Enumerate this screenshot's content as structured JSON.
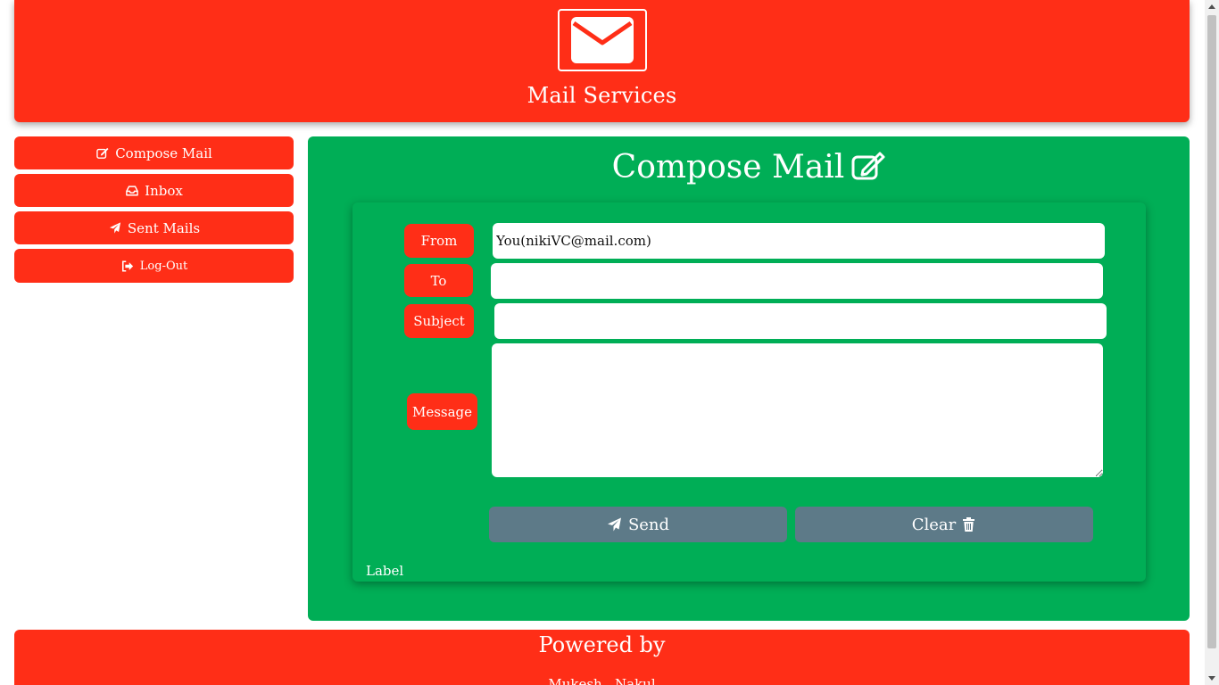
{
  "header": {
    "title": "Mail Services",
    "logo_icon": "envelope-icon"
  },
  "sidebar": {
    "items": [
      {
        "label": "Compose Mail",
        "icon": "edit-icon"
      },
      {
        "label": "Inbox",
        "icon": "inbox-icon"
      },
      {
        "label": "Sent Mails",
        "icon": "paper-plane-icon"
      },
      {
        "label": "Log-Out",
        "icon": "sign-out-icon"
      }
    ]
  },
  "compose": {
    "title": "Compose Mail",
    "from_label": "From",
    "from_value": "You(nikiVC@mail.com)",
    "to_label": "To",
    "to_value": "",
    "subject_label": "Subject",
    "subject_value": "",
    "message_label": "Message",
    "message_value": "",
    "send_label": "Send",
    "clear_label": "Clear",
    "status_label": "Label"
  },
  "footer": {
    "title": "Powered by",
    "names": "Mukesh , Nakul"
  },
  "colors": {
    "primary_red": "#ff2e17",
    "panel_green": "#00ae56",
    "button_gray": "#5d7a88"
  }
}
